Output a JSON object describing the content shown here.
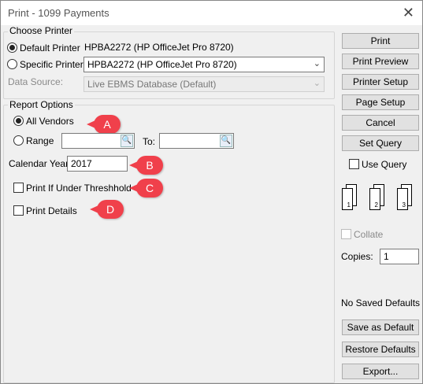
{
  "window": {
    "title": "Print - 1099 Payments",
    "close_glyph": "✕"
  },
  "printer": {
    "group_label": "Choose Printer",
    "default_label": "Default Printer",
    "default_value": "HPBA2272 (HP OfficeJet Pro 8720)",
    "specific_label": "Specific Printer",
    "specific_value": "HPBA2272 (HP OfficeJet Pro 8720)",
    "datasource_label": "Data Source:",
    "datasource_value": "Live EBMS Database (Default)"
  },
  "report": {
    "group_label": "Report Options",
    "all_vendors_label": "All Vendors",
    "range_label": "Range",
    "range_from_value": "",
    "to_label": "To:",
    "range_to_value": "",
    "calendar_year_label": "Calendar Year:",
    "calendar_year_value": "2017",
    "under_threshold_label": "Print If Under Threshhold",
    "print_details_label": "Print Details"
  },
  "annotations": {
    "a": "A",
    "b": "B",
    "c": "C",
    "d": "D"
  },
  "buttons": {
    "print": "Print",
    "preview": "Print Preview",
    "printer_setup": "Printer Setup",
    "page_setup": "Page Setup",
    "cancel": "Cancel",
    "set_query": "Set Query",
    "save_default": "Save as Default",
    "restore_defaults": "Restore Defaults",
    "export": "Export..."
  },
  "side": {
    "use_query_label": "Use Query",
    "collate_label": "Collate",
    "collate_pages": [
      "1",
      "2",
      "3"
    ],
    "copies_label": "Copies:",
    "copies_value": "1",
    "saved_defaults_text": "No Saved Defaults"
  },
  "colors": {
    "badge": "#f0404b"
  }
}
